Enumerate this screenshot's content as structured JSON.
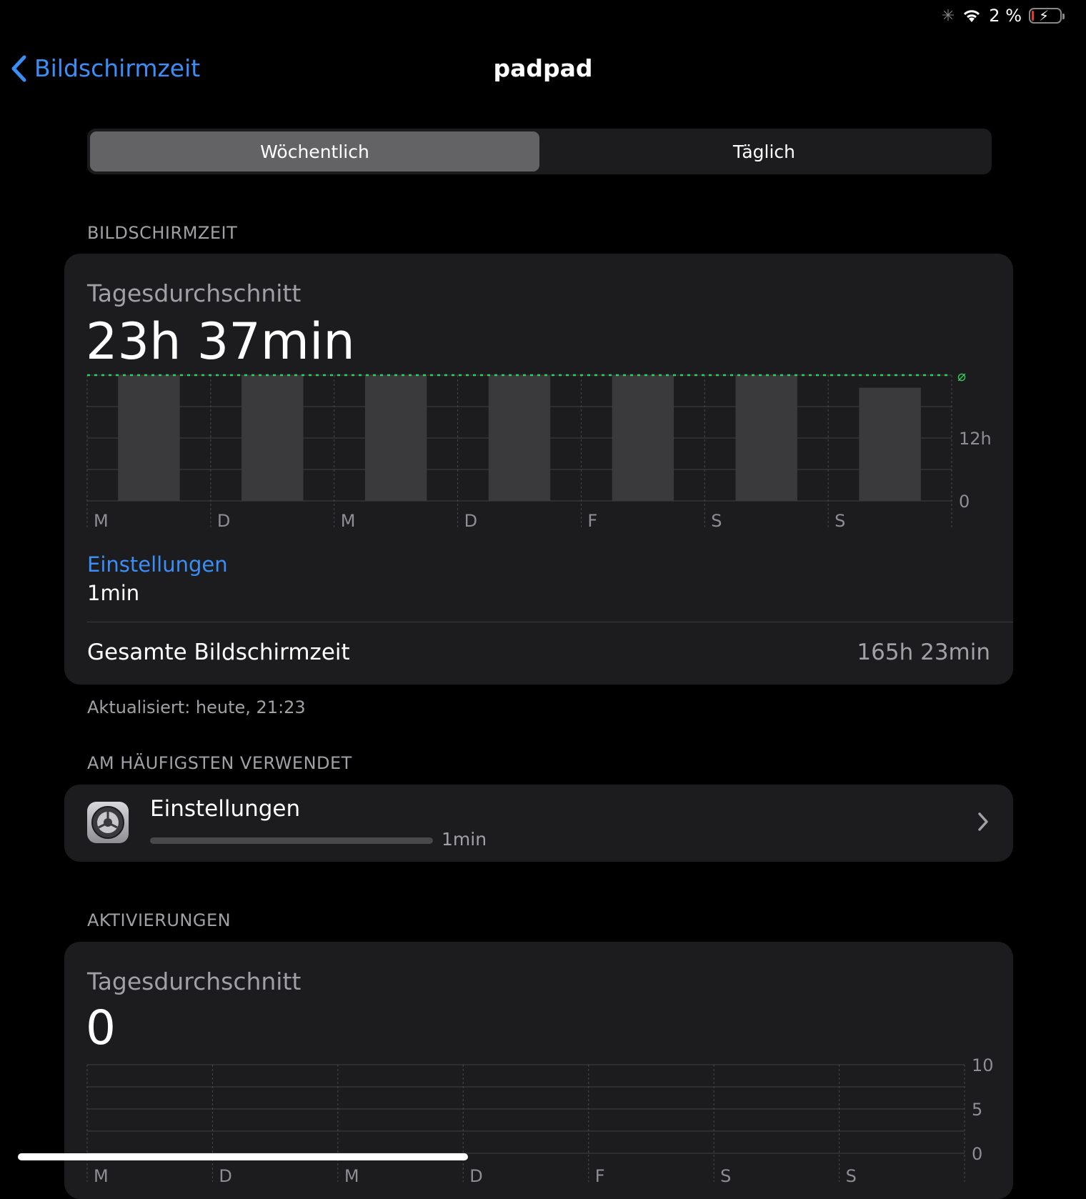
{
  "status_bar": {
    "battery_text": "2 %",
    "battery_color": "#e03b30"
  },
  "nav": {
    "back_label": "Bildschirmzeit",
    "title": "padpad"
  },
  "segmented": {
    "items": [
      "Wöchentlich",
      "Täglich"
    ],
    "selected": "Wöchentlich"
  },
  "screen_time": {
    "section_header": "BILDSCHIRMZEIT",
    "avg_label": "Tagesdurchschnitt",
    "avg_value": "23h 37min",
    "category_label": "Einstellungen",
    "category_value": "1min",
    "total_label": "Gesamte Bildschirmzeit",
    "total_value": "165h 23min",
    "updated": "Aktualisiert: heute, 21:23"
  },
  "most_used": {
    "section_header": "AM HÄUFIGSTEN VERWENDET",
    "app_name": "Einstellungen",
    "app_time": "1min",
    "app_icon": "settings-gear-icon"
  },
  "activations": {
    "section_header": "AKTIVIERUNGEN",
    "avg_label": "Tagesdurchschnitt",
    "avg_value": "0"
  },
  "chart_data": [
    {
      "type": "bar",
      "categories": [
        "M",
        "D",
        "M",
        "D",
        "F",
        "S",
        "S"
      ],
      "values": [
        24,
        24,
        24,
        24,
        24,
        24,
        21.6
      ],
      "y_ticks": [
        "0",
        "12h"
      ],
      "ylim": [
        0,
        24
      ],
      "average_marker": "⌀",
      "average_value": 23.62,
      "average_line_color": "#30d158",
      "bar_color": "#3a3a3c"
    },
    {
      "type": "bar",
      "categories": [
        "M",
        "D",
        "M",
        "D",
        "F",
        "S",
        "S"
      ],
      "values": [
        0,
        0,
        0,
        0,
        0,
        0,
        0
      ],
      "y_ticks": [
        "0",
        "5",
        "10"
      ],
      "ylim": [
        0,
        10
      ]
    }
  ]
}
